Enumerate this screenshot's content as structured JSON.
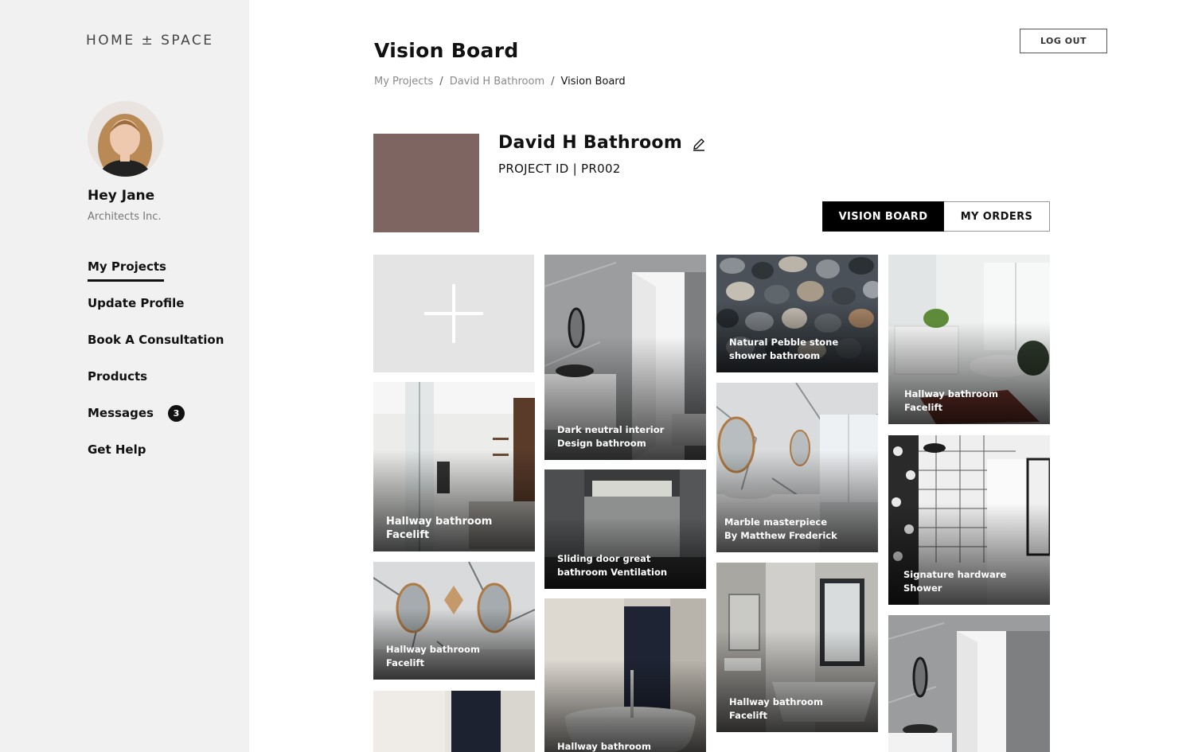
{
  "brand": "HOME ± SPACE",
  "user": {
    "greeting": "Hey Jane",
    "company": "Architects Inc."
  },
  "nav": [
    {
      "label": "My Projects"
    },
    {
      "label": "Update Profile"
    },
    {
      "label": "Book A Consultation"
    },
    {
      "label": "Products"
    },
    {
      "label": "Messages",
      "badge": "3"
    },
    {
      "label": "Get Help"
    }
  ],
  "header": {
    "title": "Vision Board",
    "logout_label": "LOG OUT"
  },
  "breadcrumb": {
    "items": [
      "My Projects",
      "David H Bathroom"
    ],
    "separator": "/",
    "current": "Vision Board"
  },
  "project": {
    "name": "David H Bathroom",
    "id_label": "PROJECT ID | PR002",
    "swatch_color": "#7e6562"
  },
  "tabs": {
    "vision_board": "VISION BOARD",
    "my_orders": "MY ORDERS"
  },
  "tiles": [
    {
      "line1": "Hallway bathroom",
      "line2": "Facelift"
    },
    {
      "line1": "Hallway bathroom",
      "line2": "Facelift"
    },
    {
      "line1": "",
      "line2": ""
    },
    {
      "line1": "Dark neutral interior",
      "line2": "Design bathroom"
    },
    {
      "line1": "Sliding door great",
      "line2": "bathroom Ventilation"
    },
    {
      "line1": "Hallway bathroom",
      "line2": ""
    },
    {
      "line1": "Natural Pebble stone",
      "line2": "shower bathroom"
    },
    {
      "line1": "Marble masterpiece",
      "line2": "By Matthew Frederick"
    },
    {
      "line1": "Hallway bathroom",
      "line2": "Facelift"
    },
    {
      "line1": "Hallway bathroom",
      "line2": "Facelift"
    },
    {
      "line1": "Signature hardware",
      "line2": "Shower"
    },
    {
      "line1": "",
      "line2": ""
    }
  ]
}
